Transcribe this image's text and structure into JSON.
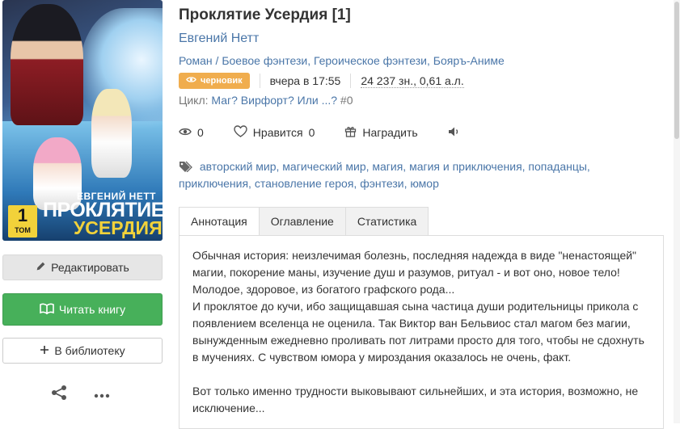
{
  "cover": {
    "author": "ЕВГЕНИЙ НЕТТ",
    "title_line1": "ПРОКЛЯТИЕ",
    "title_line2": "УСЕРДИЯ",
    "volume_number": "1",
    "volume_label": "ТОМ"
  },
  "sidebar": {
    "edit_label": "Редактировать",
    "read_label": "Читать книгу",
    "library_label": "В библиотеку"
  },
  "book": {
    "title": "Проклятие Усердия [1]",
    "author": "Евгений Нетт",
    "genres": "Роман / Боевое фэнтези, Героическое фэнтези, Бояръ-Аниме",
    "status_badge": "черновик",
    "updated": "вчера в 17:55",
    "size": "24 237 зн., 0,61 а.л.",
    "cycle_label": "Цикл:",
    "cycle_name": "Маг? Вирфорт? Или ...?",
    "cycle_number": "#0"
  },
  "actions": {
    "views": "0",
    "like_label": "Нравится",
    "likes": "0",
    "reward_label": "Наградить"
  },
  "tags_text": "авторский мир, магический мир, магия, магия и приключения, попаданцы, приключения, становление героя, фэнтези, юмор",
  "tabs": [
    {
      "label": "Аннотация"
    },
    {
      "label": "Оглавление"
    },
    {
      "label": "Статистика"
    }
  ],
  "annotation": {
    "p1": "Обычная история: неизлечимая болезнь, последняя надежда в виде \"ненастоящей\" магии, покорение маны, изучение душ и разумов, ритуал - и вот оно, новое тело! Молодое, здоровое, из богатого графского рода...",
    "p2": "И проклятое до кучи, ибо защищавшая сына частица души родительницы прикола с появлением вселенца не оценила. Так Виктор ван Бельвиос стал магом без магии, вынужденным ежедневно проливать пот литрами просто для того, чтобы не сдохнуть в мучениях. С чувством юмора у мироздания оказалось не очень, факт.",
    "p3": "Вот только именно трудности выковывают сильнейших, и эта история, возможно, не исключение..."
  },
  "colors": {
    "link": "#4a76a8",
    "read_button": "#47b05a",
    "badge": "#f0ad4e"
  },
  "icons": [
    "eye-icon",
    "heart-icon",
    "gift-icon",
    "speaker-icon",
    "tag-icon",
    "pencil-icon",
    "book-icon",
    "plus-icon",
    "share-icon",
    "more-icon"
  ]
}
